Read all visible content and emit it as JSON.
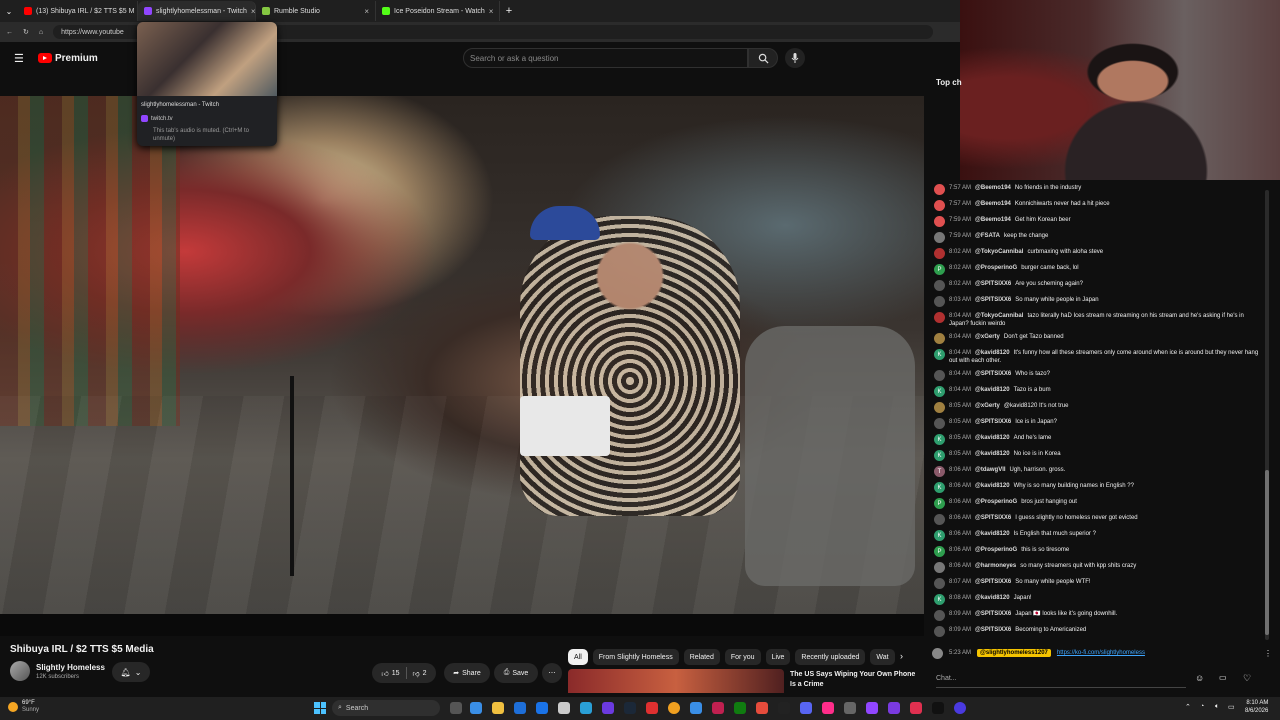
{
  "browser": {
    "tabs": [
      {
        "label": "(13) Shibuya IRL / $2 TTS $5 M",
        "color": "#ff0000"
      },
      {
        "label": "slightlyhomelessman - Twitch",
        "color": "#9146ff"
      },
      {
        "label": "Rumble Studio",
        "color": "#85c742"
      },
      {
        "label": "Ice Poseidon Stream - Watch",
        "color": "#53fc18"
      }
    ],
    "url": "https://www.youtube"
  },
  "tab_preview": {
    "title": "slightlyhomelessman - Twitch",
    "site": "twitch.tv",
    "muted_note": "This tab's audio is muted. (Ctrl+M to unmute)"
  },
  "youtube": {
    "logo": "Premium",
    "search_placeholder": "Search or ask a question"
  },
  "video": {
    "title": "Shibuya IRL / $2 TTS $5 Media",
    "channel": "Slightly Homeless",
    "subscribers": "12K subscribers",
    "likes": "15",
    "dislikes": "2",
    "share": "Share",
    "save": "Save"
  },
  "chips": [
    "All",
    "From Slightly Homeless",
    "Related",
    "For you",
    "Live",
    "Recently uploaded",
    "Wat"
  ],
  "recommended": {
    "title": "The US Says Wiping Your Own Phone Is a Crime"
  },
  "chat": {
    "header": "Top ch",
    "messages": [
      {
        "time": "7:57 AM",
        "user": "@Beemo194",
        "text": "No friends in the industry",
        "color": "#e05050",
        "init": ""
      },
      {
        "time": "7:57 AM",
        "user": "@Beemo194",
        "text": "Konnichiwarts never had a hit piece",
        "color": "#e05050",
        "init": ""
      },
      {
        "time": "7:59 AM",
        "user": "@Beemo194",
        "text": "Get him Korean beer",
        "color": "#e05050",
        "init": ""
      },
      {
        "time": "7:59 AM",
        "user": "@FSATA",
        "text": "keep the change",
        "color": "#777777",
        "init": ""
      },
      {
        "time": "8:02 AM",
        "user": "@TokyoCannibal",
        "text": "curbmaxing with aloha steve",
        "color": "#b03030",
        "init": ""
      },
      {
        "time": "8:02 AM",
        "user": "@ProsperinoG",
        "text": "burger came back, lol",
        "color": "#2e9e4e",
        "init": "P"
      },
      {
        "time": "8:02 AM",
        "user": "@SPITSIXX6",
        "text": "Are you scheming again?",
        "color": "#555555",
        "init": ""
      },
      {
        "time": "8:03 AM",
        "user": "@SPITSIXX6",
        "text": "So many white people in Japan",
        "color": "#555555",
        "init": ""
      },
      {
        "time": "8:04 AM",
        "user": "@TokyoCannibal",
        "text": "tazo literally haD Ices stream re streaming on his stream and he's asking if he's in Japan? fuckin weirdo",
        "color": "#b03030",
        "init": ""
      },
      {
        "time": "8:04 AM",
        "user": "@xGerty",
        "text": "Don't get Tazo banned",
        "color": "#a08040",
        "init": ""
      },
      {
        "time": "8:04 AM",
        "user": "@kavid8120",
        "text": "It's funny how all these streamers only come around when ice is around but they never hang out with each other.",
        "color": "#2e9e6e",
        "init": "K"
      },
      {
        "time": "8:04 AM",
        "user": "@SPITSIXX6",
        "text": "Who is tazo?",
        "color": "#555555",
        "init": ""
      },
      {
        "time": "8:04 AM",
        "user": "@kavid8120",
        "text": "Tazo is a bum",
        "color": "#2e9e6e",
        "init": "K"
      },
      {
        "time": "8:05 AM",
        "user": "@xGerty",
        "text": "@kavid8120 It's not true",
        "color": "#a08040",
        "init": ""
      },
      {
        "time": "8:05 AM",
        "user": "@SPITSIXX6",
        "text": "Ice is in Japan?",
        "color": "#555555",
        "init": ""
      },
      {
        "time": "8:05 AM",
        "user": "@kavid8120",
        "text": "And he's lame",
        "color": "#2e9e6e",
        "init": "K"
      },
      {
        "time": "8:05 AM",
        "user": "@kavid8120",
        "text": "No ice is in Korea",
        "color": "#2e9e6e",
        "init": "K"
      },
      {
        "time": "8:06 AM",
        "user": "@tdawgVII",
        "text": "Ugh, harrison. gross.",
        "color": "#8a5a6a",
        "init": "T"
      },
      {
        "time": "8:06 AM",
        "user": "@kavid8120",
        "text": "Why is so many building names in English ??",
        "color": "#2e9e6e",
        "init": "K"
      },
      {
        "time": "8:06 AM",
        "user": "@ProsperinoG",
        "text": "bros just hanging out",
        "color": "#2e9e4e",
        "init": "P"
      },
      {
        "time": "8:06 AM",
        "user": "@SPITSIXX6",
        "text": "I guess slightly no homeless never got evicted",
        "color": "#555555",
        "init": ""
      },
      {
        "time": "8:06 AM",
        "user": "@kavid8120",
        "text": "Is English that much superior ?",
        "color": "#2e9e6e",
        "init": "K"
      },
      {
        "time": "8:06 AM",
        "user": "@ProsperinoG",
        "text": "this is so tiresome",
        "color": "#2e9e4e",
        "init": "P"
      },
      {
        "time": "8:06 AM",
        "user": "@harmoneyes",
        "text": "so many streamers quit with kpp shits crazy",
        "color": "#777777",
        "init": ""
      },
      {
        "time": "8:07 AM",
        "user": "@SPITSIXX6",
        "text": "So many white people WTF!",
        "color": "#555555",
        "init": ""
      },
      {
        "time": "8:08 AM",
        "user": "@kavid8120",
        "text": "Japan!",
        "color": "#2e9e6e",
        "init": "K"
      },
      {
        "time": "8:09 AM",
        "user": "@SPITSIXX6",
        "text": "Japan 🇯🇵 looks like it's going downhill.",
        "color": "#555555",
        "init": ""
      },
      {
        "time": "8:09 AM",
        "user": "@SPITSIXX6",
        "text": "Becoming to Americanized",
        "color": "#555555",
        "init": ""
      }
    ],
    "pinned_user": "@slightlyhomeless1207",
    "pinned_time": "5:23 AM",
    "pinned_link": "https://ko-fi.com/slightlyhomeless",
    "input_placeholder": "Chat..."
  },
  "taskbar": {
    "temp": "69°F",
    "condition": "Sunny",
    "search": "Search",
    "time": "8:10 AM",
    "date": "8/6/2026"
  }
}
